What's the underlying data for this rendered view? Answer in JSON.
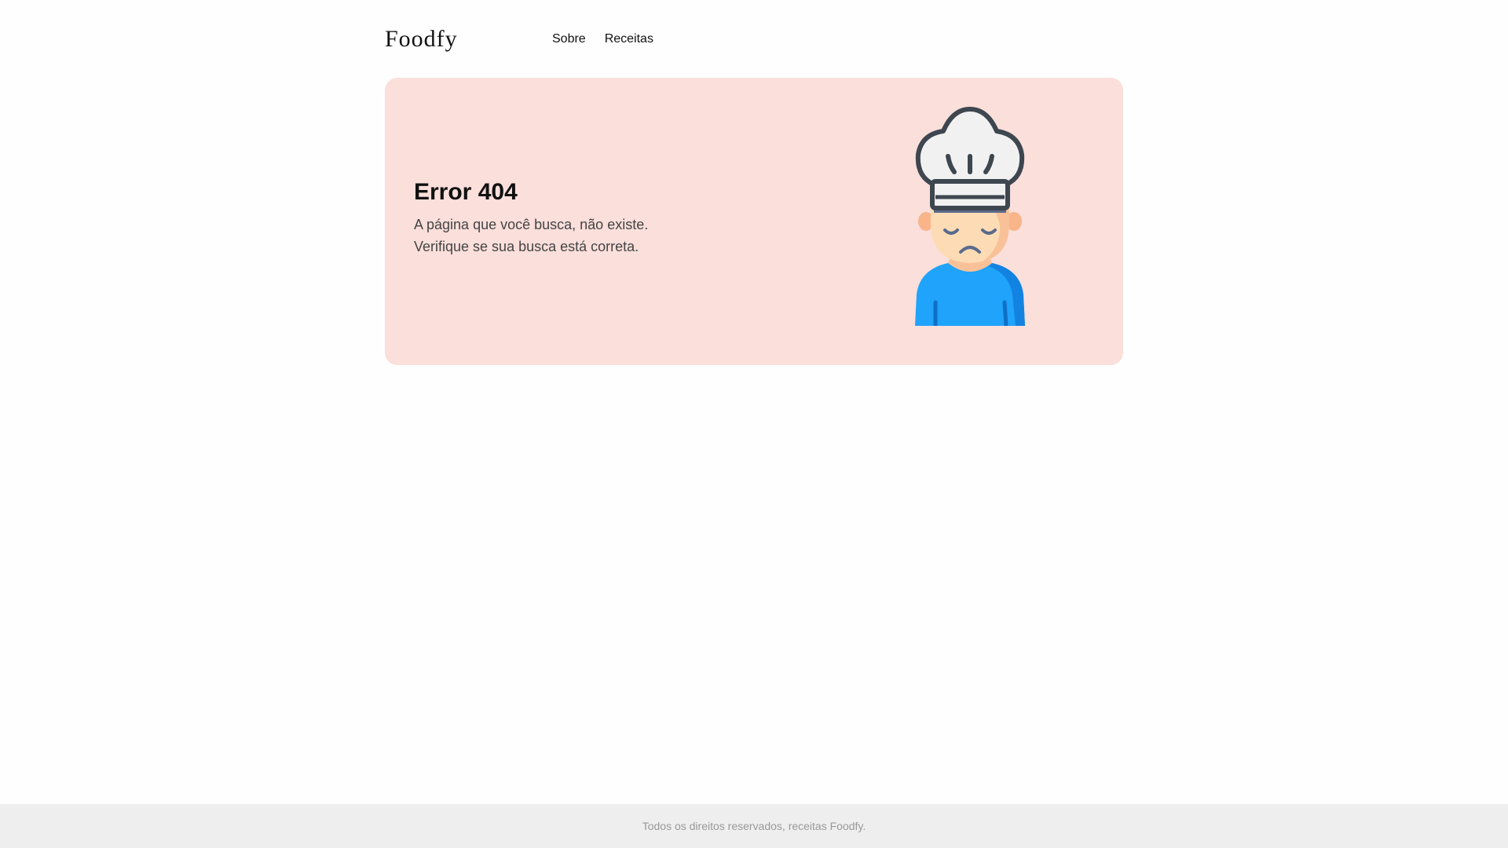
{
  "header": {
    "logo": "Foodfy",
    "nav": [
      {
        "label": "Sobre"
      },
      {
        "label": "Receitas"
      }
    ]
  },
  "error": {
    "title": "Error 404",
    "line1": "A página que você busca, não existe.",
    "line2": "Verifique se sua busca está correta.",
    "illustration": "sad-chef-icon"
  },
  "footer": {
    "text": "Todos os direitos reservados, receitas Foodfy."
  },
  "colors": {
    "card_bg": "#fadfdb",
    "footer_bg": "#eeeeee",
    "chef_shirt": "#1fa3fb",
    "chef_hat": "#f1f1f1"
  }
}
